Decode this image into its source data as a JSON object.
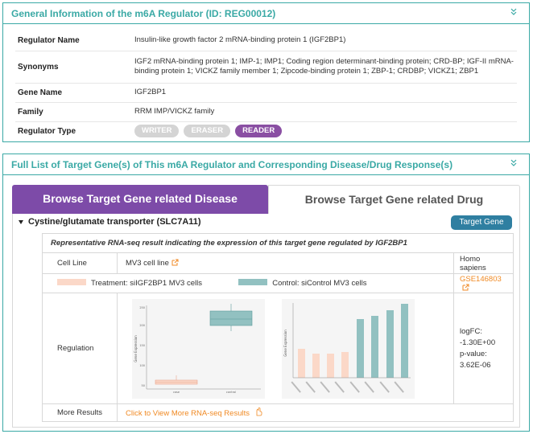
{
  "panel1": {
    "title": "General Information of the m6A Regulator (ID: REG00012)",
    "rows": [
      {
        "label": "Regulator Name",
        "value": "Insulin-like growth factor 2 mRNA-binding protein 1 (IGF2BP1)"
      },
      {
        "label": "Synonyms",
        "value": "IGF2 mRNA-binding protein 1; IMP-1; IMP1; Coding region determinant-binding protein; CRD-BP; IGF-II mRNA-binding protein 1; VICKZ family member 1; Zipcode-binding protein 1; ZBP-1; CRDBP; VICKZ1; ZBP1"
      },
      {
        "label": "Gene Name",
        "value": "IGF2BP1"
      },
      {
        "label": "Family",
        "value": "RRM IMP/VICKZ family"
      },
      {
        "label": "Regulator Type",
        "value": ""
      }
    ],
    "types": [
      {
        "label": "WRITER",
        "active": false
      },
      {
        "label": "ERASER",
        "active": false
      },
      {
        "label": "READER",
        "active": true
      }
    ]
  },
  "panel2": {
    "title": "Full List of Target Gene(s) of This m6A Regulator and Corresponding Disease/Drug Response(s)",
    "tabs": [
      {
        "label": "Browse Target Gene related Disease",
        "active": true
      },
      {
        "label": "Browse Target Gene related Drug",
        "active": false
      }
    ],
    "gene": {
      "title": "Cystine/glutamate transporter (SLC7A11)",
      "button": "Target Gene"
    },
    "result": {
      "caption": "Representative RNA-seq result indicating the expression of this target gene regulated by IGF2BP1",
      "cell_line_label": "Cell Line",
      "cell_line_value": "MV3 cell line",
      "species": "Homo sapiens",
      "treatment": "Treatment: siIGF2BP1 MV3 cells",
      "control": "Control: siControl MV3 cells",
      "geo": "GSE146803",
      "regulation_label": "Regulation",
      "logfc": "logFC: -1.30E+00",
      "pvalue": "p-value: 3.62E-06",
      "more_label": "More Results",
      "more_link": "Click to View More RNA-seq Results"
    },
    "plot_labels": {
      "box_ylabel": "Gene Expression",
      "box_x": [
        "case",
        "control"
      ],
      "box_y_ticks": [
        "50",
        "100",
        "150",
        "200",
        "250"
      ],
      "bar_ylabel": "Gene Expression"
    }
  },
  "colors": {
    "teal": "#3aa9a5",
    "purple": "#7d4ba8",
    "reader": "#8a4fa3",
    "button": "#2f7fa1",
    "link": "#f08a24",
    "treatment": "#fbd8c8",
    "control": "#92c1c1"
  }
}
